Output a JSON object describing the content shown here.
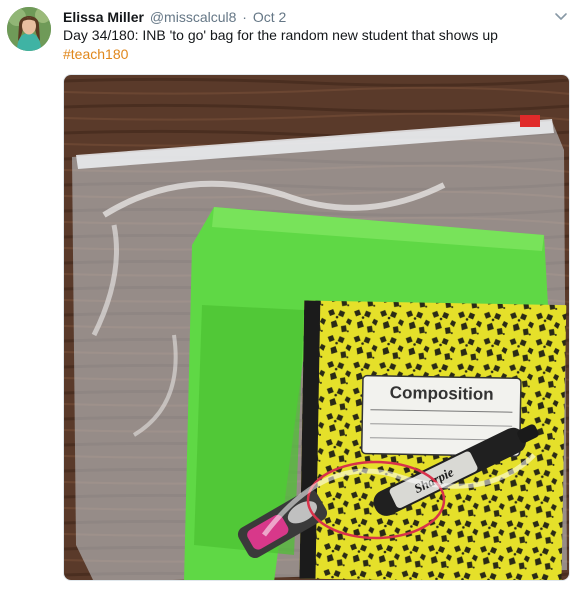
{
  "tweet": {
    "author": {
      "display_name": "Elissa Miller",
      "handle": "@misscalcul8"
    },
    "separator": "·",
    "date": "Oct 2",
    "text": "Day 34/180: INB 'to go' bag for the random new student that shows up",
    "hashtag": "#teach180",
    "media": {
      "notebook_label": "Composition",
      "marker_brand": "Sharpie"
    }
  },
  "colors": {
    "hashtag": "#e0871b",
    "secondary_text": "#657786"
  }
}
